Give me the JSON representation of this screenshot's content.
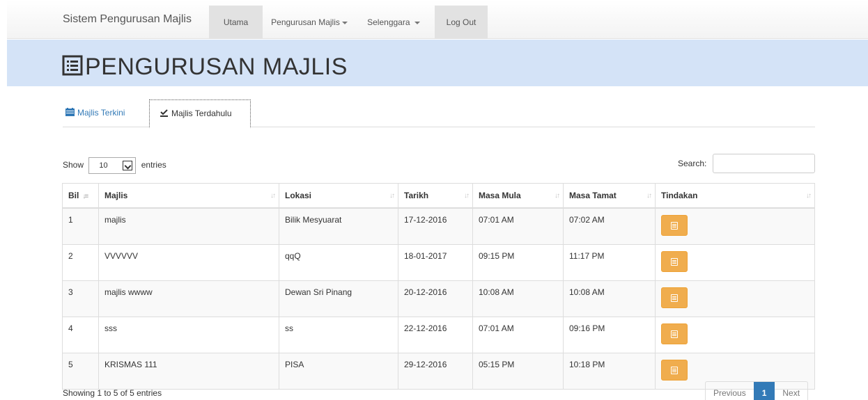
{
  "navbar": {
    "brand": "Sistem Pengurusan Majlis",
    "items": [
      {
        "label": "Utama",
        "active": true
      },
      {
        "label": "Pengurusan Majlis",
        "dropdown": true
      },
      {
        "label": "Selenggara",
        "dropdown": true
      },
      {
        "label": "Log Out",
        "active": true
      }
    ]
  },
  "header": {
    "title": "PENGURUSAN MAJLIS",
    "icon": "list-alt-icon"
  },
  "tabs": [
    {
      "label": "Majlis Terkini",
      "icon": "calendar-icon",
      "active": false
    },
    {
      "label": "Majlis Terdahulu",
      "icon": "check-square-icon",
      "active": true
    }
  ],
  "controls": {
    "show_label": "Show",
    "entries_value": "10",
    "entries_label": "entries",
    "search_label": "Search:",
    "search_value": ""
  },
  "table": {
    "columns": [
      "Bil",
      "Majlis",
      "Lokasi",
      "Tarikh",
      "Masa Mula",
      "Masa Tamat",
      "Tindakan"
    ],
    "rows": [
      {
        "bil": "1",
        "majlis": "majlis",
        "lokasi": "Bilik Mesyuarat",
        "tarikh": "17-12-2016",
        "mula": "07:01 AM",
        "tamat": "07:02 AM"
      },
      {
        "bil": "2",
        "majlis": "VVVVVV",
        "lokasi": "qqQ",
        "tarikh": "18-01-2017",
        "mula": "09:15 PM",
        "tamat": "11:17 PM"
      },
      {
        "bil": "3",
        "majlis": "majlis wwww",
        "lokasi": "Dewan Sri Pinang",
        "tarikh": "20-12-2016",
        "mula": "10:08 AM",
        "tamat": "10:08 AM"
      },
      {
        "bil": "4",
        "majlis": "sss",
        "lokasi": "ss",
        "tarikh": "22-12-2016",
        "mula": "07:01 AM",
        "tamat": "09:16 PM"
      },
      {
        "bil": "5",
        "majlis": "KRISMAS 111",
        "lokasi": "PISA",
        "tarikh": "29-12-2016",
        "mula": "05:15 PM",
        "tamat": "10:18 PM"
      }
    ]
  },
  "footer": {
    "info": "Showing 1 to 5 of 5 entries",
    "previous": "Previous",
    "page": "1",
    "next": "Next"
  },
  "colors": {
    "header_band": "#d4e3f7",
    "action_button": "#f0ad4e",
    "link": "#337ab7",
    "active_page": "#337ab7"
  }
}
